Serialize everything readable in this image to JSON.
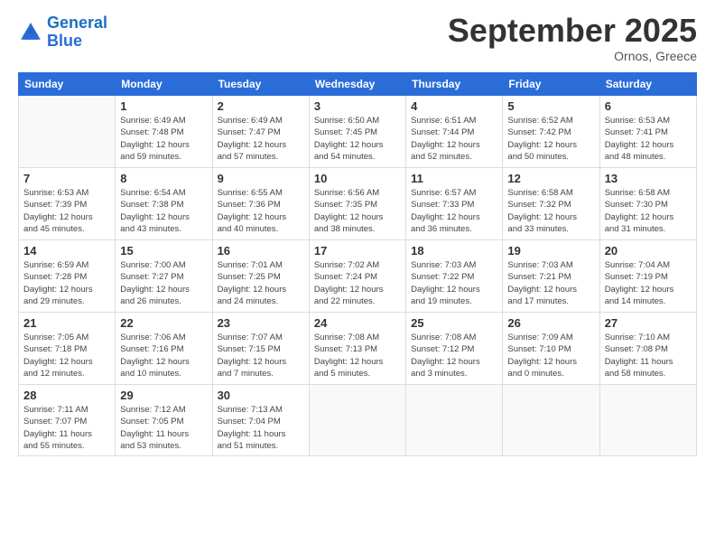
{
  "logo": {
    "line1": "General",
    "line2": "Blue"
  },
  "title": "September 2025",
  "location": "Ornos, Greece",
  "days_of_week": [
    "Sunday",
    "Monday",
    "Tuesday",
    "Wednesday",
    "Thursday",
    "Friday",
    "Saturday"
  ],
  "weeks": [
    [
      {
        "day": "",
        "info": ""
      },
      {
        "day": "1",
        "info": "Sunrise: 6:49 AM\nSunset: 7:48 PM\nDaylight: 12 hours\nand 59 minutes."
      },
      {
        "day": "2",
        "info": "Sunrise: 6:49 AM\nSunset: 7:47 PM\nDaylight: 12 hours\nand 57 minutes."
      },
      {
        "day": "3",
        "info": "Sunrise: 6:50 AM\nSunset: 7:45 PM\nDaylight: 12 hours\nand 54 minutes."
      },
      {
        "day": "4",
        "info": "Sunrise: 6:51 AM\nSunset: 7:44 PM\nDaylight: 12 hours\nand 52 minutes."
      },
      {
        "day": "5",
        "info": "Sunrise: 6:52 AM\nSunset: 7:42 PM\nDaylight: 12 hours\nand 50 minutes."
      },
      {
        "day": "6",
        "info": "Sunrise: 6:53 AM\nSunset: 7:41 PM\nDaylight: 12 hours\nand 48 minutes."
      }
    ],
    [
      {
        "day": "7",
        "info": "Sunrise: 6:53 AM\nSunset: 7:39 PM\nDaylight: 12 hours\nand 45 minutes."
      },
      {
        "day": "8",
        "info": "Sunrise: 6:54 AM\nSunset: 7:38 PM\nDaylight: 12 hours\nand 43 minutes."
      },
      {
        "day": "9",
        "info": "Sunrise: 6:55 AM\nSunset: 7:36 PM\nDaylight: 12 hours\nand 40 minutes."
      },
      {
        "day": "10",
        "info": "Sunrise: 6:56 AM\nSunset: 7:35 PM\nDaylight: 12 hours\nand 38 minutes."
      },
      {
        "day": "11",
        "info": "Sunrise: 6:57 AM\nSunset: 7:33 PM\nDaylight: 12 hours\nand 36 minutes."
      },
      {
        "day": "12",
        "info": "Sunrise: 6:58 AM\nSunset: 7:32 PM\nDaylight: 12 hours\nand 33 minutes."
      },
      {
        "day": "13",
        "info": "Sunrise: 6:58 AM\nSunset: 7:30 PM\nDaylight: 12 hours\nand 31 minutes."
      }
    ],
    [
      {
        "day": "14",
        "info": "Sunrise: 6:59 AM\nSunset: 7:28 PM\nDaylight: 12 hours\nand 29 minutes."
      },
      {
        "day": "15",
        "info": "Sunrise: 7:00 AM\nSunset: 7:27 PM\nDaylight: 12 hours\nand 26 minutes."
      },
      {
        "day": "16",
        "info": "Sunrise: 7:01 AM\nSunset: 7:25 PM\nDaylight: 12 hours\nand 24 minutes."
      },
      {
        "day": "17",
        "info": "Sunrise: 7:02 AM\nSunset: 7:24 PM\nDaylight: 12 hours\nand 22 minutes."
      },
      {
        "day": "18",
        "info": "Sunrise: 7:03 AM\nSunset: 7:22 PM\nDaylight: 12 hours\nand 19 minutes."
      },
      {
        "day": "19",
        "info": "Sunrise: 7:03 AM\nSunset: 7:21 PM\nDaylight: 12 hours\nand 17 minutes."
      },
      {
        "day": "20",
        "info": "Sunrise: 7:04 AM\nSunset: 7:19 PM\nDaylight: 12 hours\nand 14 minutes."
      }
    ],
    [
      {
        "day": "21",
        "info": "Sunrise: 7:05 AM\nSunset: 7:18 PM\nDaylight: 12 hours\nand 12 minutes."
      },
      {
        "day": "22",
        "info": "Sunrise: 7:06 AM\nSunset: 7:16 PM\nDaylight: 12 hours\nand 10 minutes."
      },
      {
        "day": "23",
        "info": "Sunrise: 7:07 AM\nSunset: 7:15 PM\nDaylight: 12 hours\nand 7 minutes."
      },
      {
        "day": "24",
        "info": "Sunrise: 7:08 AM\nSunset: 7:13 PM\nDaylight: 12 hours\nand 5 minutes."
      },
      {
        "day": "25",
        "info": "Sunrise: 7:08 AM\nSunset: 7:12 PM\nDaylight: 12 hours\nand 3 minutes."
      },
      {
        "day": "26",
        "info": "Sunrise: 7:09 AM\nSunset: 7:10 PM\nDaylight: 12 hours\nand 0 minutes."
      },
      {
        "day": "27",
        "info": "Sunrise: 7:10 AM\nSunset: 7:08 PM\nDaylight: 11 hours\nand 58 minutes."
      }
    ],
    [
      {
        "day": "28",
        "info": "Sunrise: 7:11 AM\nSunset: 7:07 PM\nDaylight: 11 hours\nand 55 minutes."
      },
      {
        "day": "29",
        "info": "Sunrise: 7:12 AM\nSunset: 7:05 PM\nDaylight: 11 hours\nand 53 minutes."
      },
      {
        "day": "30",
        "info": "Sunrise: 7:13 AM\nSunset: 7:04 PM\nDaylight: 11 hours\nand 51 minutes."
      },
      {
        "day": "",
        "info": ""
      },
      {
        "day": "",
        "info": ""
      },
      {
        "day": "",
        "info": ""
      },
      {
        "day": "",
        "info": ""
      }
    ]
  ]
}
